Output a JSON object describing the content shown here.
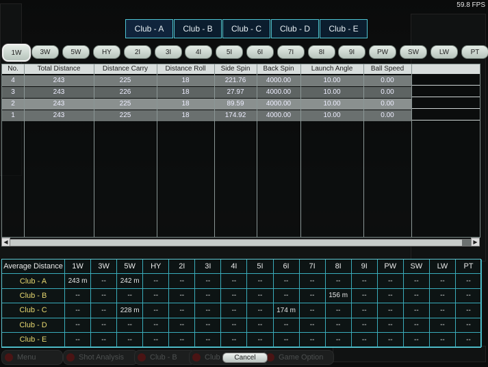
{
  "fps": "59.8 FPS",
  "club_tabs": [
    "Club - A",
    "Club - B",
    "Club - C",
    "Club - D",
    "Club - E"
  ],
  "clubs": [
    "1W",
    "3W",
    "5W",
    "HY",
    "2I",
    "3I",
    "4I",
    "5I",
    "6I",
    "7I",
    "8I",
    "9I",
    "PW",
    "SW",
    "LW",
    "PT"
  ],
  "selected_club": "1W",
  "shot_table": {
    "headers": [
      "No.",
      "Total Distance",
      "Distance Carry",
      "Distance Roll",
      "Side Spin",
      "Back Spin",
      "Launch Angle",
      "Ball Speed"
    ],
    "rows": [
      [
        "4",
        "243",
        "225",
        "18",
        "221.76",
        "4000.00",
        "10.00",
        "0.00"
      ],
      [
        "3",
        "243",
        "226",
        "18",
        "27.97",
        "4000.00",
        "10.00",
        "0.00"
      ],
      [
        "2",
        "243",
        "225",
        "18",
        "89.59",
        "4000.00",
        "10.00",
        "0.00"
      ],
      [
        "1",
        "243",
        "225",
        "18",
        "174.92",
        "4000.00",
        "10.00",
        "0.00"
      ]
    ]
  },
  "avg_table": {
    "header_label": "Average Distance",
    "columns": [
      "1W",
      "3W",
      "5W",
      "HY",
      "2I",
      "3I",
      "4I",
      "5I",
      "6I",
      "7I",
      "8I",
      "9I",
      "PW",
      "SW",
      "LW",
      "PT"
    ],
    "rows": [
      {
        "club": "Club - A",
        "values": [
          "243 m",
          "--",
          "242 m",
          "--",
          "--",
          "--",
          "--",
          "--",
          "--",
          "--",
          "--",
          "--",
          "--",
          "--",
          "--",
          "--"
        ]
      },
      {
        "club": "Club - B",
        "values": [
          "--",
          "--",
          "--",
          "--",
          "--",
          "--",
          "--",
          "--",
          "--",
          "--",
          "156 m",
          "--",
          "--",
          "--",
          "--",
          "--"
        ]
      },
      {
        "club": "Club - C",
        "values": [
          "--",
          "--",
          "228 m",
          "--",
          "--",
          "--",
          "--",
          "--",
          "174 m",
          "--",
          "--",
          "--",
          "--",
          "--",
          "--",
          "--"
        ]
      },
      {
        "club": "Club - D",
        "values": [
          "--",
          "--",
          "--",
          "--",
          "--",
          "--",
          "--",
          "--",
          "--",
          "--",
          "--",
          "--",
          "--",
          "--",
          "--",
          "--"
        ]
      },
      {
        "club": "Club - E",
        "values": [
          "--",
          "--",
          "--",
          "--",
          "--",
          "--",
          "--",
          "--",
          "--",
          "--",
          "--",
          "--",
          "--",
          "--",
          "--",
          "--"
        ]
      }
    ]
  },
  "bottom_buttons": [
    "Menu",
    "Shot Analysis",
    "Club - B",
    "Club Info",
    "Game Option"
  ],
  "cancel_label": "Cancel"
}
